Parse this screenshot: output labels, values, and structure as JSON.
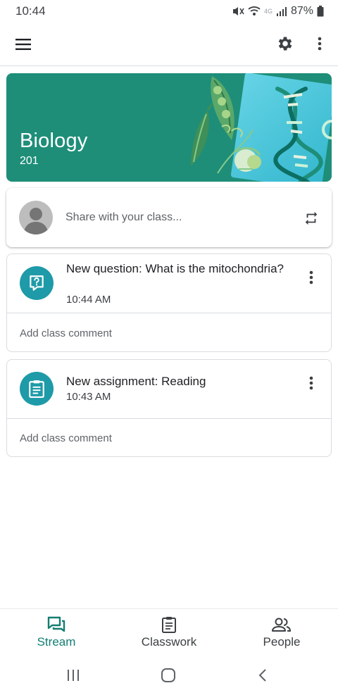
{
  "status_bar": {
    "time": "10:44",
    "battery_percent": "87%",
    "network": "4G",
    "icons": [
      "mute-icon",
      "wifi-icon",
      "signal-icon",
      "battery-icon"
    ]
  },
  "app_bar": {
    "icons": [
      "menu-icon",
      "settings-icon",
      "more-vert-icon"
    ]
  },
  "class_banner": {
    "title": "Biology",
    "section": "201",
    "color": "#1e8e79"
  },
  "share_box": {
    "placeholder": "Share with your class...",
    "icons": [
      "avatar-placeholder-icon",
      "repost-icon"
    ]
  },
  "posts": [
    {
      "icon": "question-icon",
      "title": "New question: What is the mitochondria?",
      "time": "10:44 AM",
      "comment_link": "Add class comment"
    },
    {
      "icon": "assignment-icon",
      "title": "New assignment: Reading",
      "time": "10:43 AM",
      "comment_link": "Add class comment"
    }
  ],
  "bottom_nav": {
    "items": [
      {
        "label": "Stream",
        "icon": "stream-icon",
        "active": true
      },
      {
        "label": "Classwork",
        "icon": "classwork-icon",
        "active": false
      },
      {
        "label": "People",
        "icon": "people-icon",
        "active": false
      }
    ],
    "active_color": "#137e72"
  },
  "system_nav": {
    "icons": [
      "recents-icon",
      "home-icon",
      "back-icon"
    ]
  },
  "colors": {
    "post_icon_bg": "#1e9aa8",
    "divider": "#dadce0"
  }
}
